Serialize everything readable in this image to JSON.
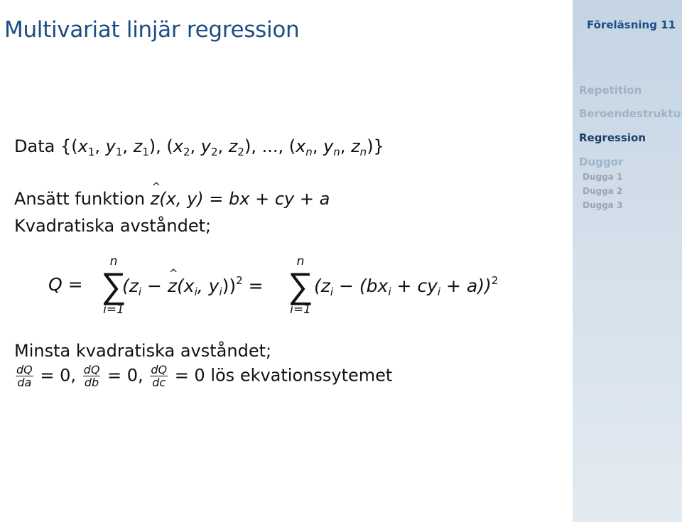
{
  "slide": {
    "title": "Multivariat linjär regression",
    "data_label": "Data",
    "data_set": {
      "open": "{(",
      "x1": "x",
      "s1": "1",
      "y1": "y",
      "t1": "1",
      "z1": "z",
      "u1": "1",
      "mid1": "), (",
      "x2": "x",
      "s2": "2",
      "y2": "y",
      "t2": "2",
      "z2": "z",
      "u2": "2",
      "mid2": "), ..., (",
      "xn": "x",
      "sn": "n",
      "yn": "y",
      "tn": "n",
      "zn": "z",
      "un": "n",
      "close": ")}"
    },
    "ansatt_label": "Ansätt funktion",
    "model": {
      "lhs": "z(x, y)",
      "rhs": " = bx + cy + a"
    },
    "kvadratiska_label": "Kvadratiska avståndet;",
    "equation": {
      "lhs": "Q =",
      "sum_upper": "n",
      "sum_lower": "i=1",
      "sigma": "∑",
      "term1_open": "(z",
      "term1_sub": "i",
      "term1_mid": " − ",
      "term1_hat": "z",
      "term1_args_open": "(x",
      "term1_args_sub1": "i",
      "term1_args_comma": ", y",
      "term1_args_sub2": "i",
      "term1_close": "))",
      "term1_sup": "2",
      "eq2": " =",
      "term2_open": "(z",
      "term2_sub": "i",
      "term2_mid": " − (bx",
      "term2_sub2": "i",
      "term2_plus": " + cy",
      "term2_sub3": "i",
      "term2_close": " + a))",
      "term2_sup": "2"
    },
    "minsta_label": "Minsta kvadratiska avståndet;",
    "derivatives": [
      {
        "num": "dQ",
        "den": "da",
        "tail": " = 0, "
      },
      {
        "num": "dQ",
        "den": "db",
        "tail": " = 0, "
      },
      {
        "num": "dQ",
        "den": "dc",
        "tail": " = 0 "
      }
    ],
    "solve_text": "lös ekvationssytemet"
  },
  "sidebar": {
    "title": "Föreläsning 11",
    "sections": [
      {
        "label": "Repetition",
        "active": false
      },
      {
        "label": "Beroendestrukturer",
        "active": false
      },
      {
        "label": "Regression",
        "active": true
      },
      {
        "label": "Duggor",
        "active": false
      }
    ],
    "subsections": [
      {
        "label": "Dugga 1"
      },
      {
        "label": "Dugga 2"
      },
      {
        "label": "Dugga 3"
      }
    ]
  },
  "colors": {
    "title": "#1c4d83",
    "sidebar_active": "#1b3f66",
    "sidebar_inactive": "#9fb4c9",
    "sidebar_bg_top": "#c4d4e3",
    "sidebar_bg_bottom": "#e3eaf1"
  }
}
